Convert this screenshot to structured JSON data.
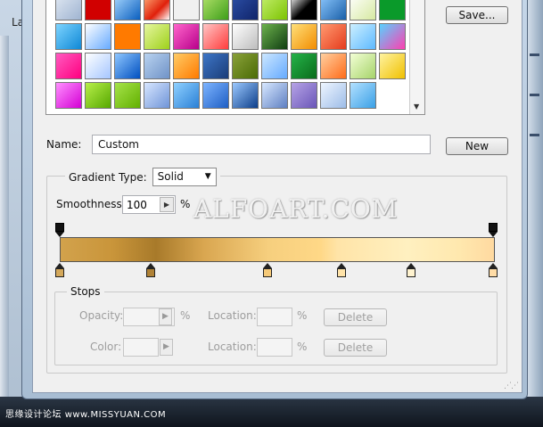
{
  "background": {
    "window_title": "Lay",
    "watermark_bottom_cn": "思缘设计论坛",
    "watermark_bottom_url": "www.MISSYUAN.COM"
  },
  "watermark": "ALFOART.COM",
  "presets": {
    "save_label": "Save...",
    "swatches": [
      "linear-gradient(135deg,#dfe7f2,#9fb4d1)",
      "#d10000",
      "linear-gradient(135deg,#a9d8ff,#0a5fbf)",
      "linear-gradient(135deg,#ffb07a,#e0200a 60%,#fff)",
      "#f0f0f0",
      "linear-gradient(135deg,#b4e36b,#3d9e1a)",
      "linear-gradient(135deg,#2c4fa6,#10246a)",
      "linear-gradient(135deg,#c4ef6f,#7cc300)",
      "linear-gradient(135deg,#ffffff,#000000 55%)",
      "linear-gradient(135deg,#8ec9ff,#1a5fa8)",
      "linear-gradient(135deg,#ffffff,#d6e9a0)",
      "",
      "#0a9a2a",
      "linear-gradient(135deg,#7ed4ff,#0f88d6)",
      "linear-gradient(135deg,#ffffff,#66aaff)",
      "#ff7a00",
      "linear-gradient(135deg,#e6f6a0,#9ed11a)",
      "linear-gradient(135deg,#ff66cc,#b8008a)",
      "linear-gradient(135deg,#ffc6c6,#ff3c3c)",
      "linear-gradient(135deg,#ffffff,#bdbdbd)",
      "linear-gradient(135deg,#6db24c,#0f3d12)",
      "linear-gradient(135deg,#ffe07a,#f28c00)",
      "linear-gradient(135deg,#ff9a70,#e53b1c)",
      "linear-gradient(135deg,#cdefff,#5db9ff)",
      "linear-gradient(135deg,#58d1ff,#ff3fb0)",
      "linear-gradient(135deg,#ff5bc0,#ff007f)",
      "linear-gradient(135deg,#ffffff,#a5c6ff)",
      "linear-gradient(135deg,#8fc7ff,#0050c0)",
      "linear-gradient(135deg,#b9d3f0,#6f92c7)",
      "linear-gradient(135deg,#ffcc66,#ff7a00)",
      "linear-gradient(135deg,#3e76c7,#1a3c78)",
      "linear-gradient(135deg,#8aa13a,#4a6b05)",
      "linear-gradient(135deg,#cce7ff,#66aaff)",
      "linear-gradient(135deg,#25b34a,#0a6b1a)",
      "linear-gradient(135deg,#ffd0a0,#ff6b1a)",
      "linear-gradient(135deg,#f3ffd6,#a6d36a)",
      "linear-gradient(135deg,#fff3a0,#f0c000)",
      "linear-gradient(135deg,#ff90ff,#d400d4)",
      "linear-gradient(135deg,#b8ef4a,#56a800)",
      "linear-gradient(135deg,#a6e34a,#62b000)",
      "linear-gradient(135deg,#d7e6ff,#6f94d8)",
      "linear-gradient(135deg,#8fd0ff,#2a80d6)",
      "linear-gradient(135deg,#7db4ff,#1e5ec4)",
      "linear-gradient(135deg,#9cc9ff,#0c3e8a)",
      "linear-gradient(135deg,#d8e8ff,#5e7fc2)",
      "linear-gradient(135deg,#b6a3e6,#6a56b8)",
      "linear-gradient(135deg,#eef5ff,#9dbde8)",
      "linear-gradient(135deg,#b3e0ff,#3aa0e6)"
    ]
  },
  "name": {
    "label": "Name:",
    "value": "Custom",
    "new_label": "New"
  },
  "gradient_type": {
    "label": "Gradient Type:",
    "value": "Solid"
  },
  "smoothness": {
    "label": "Smoothness:",
    "value": "100",
    "unit": "%"
  },
  "gradient": {
    "css": "linear-gradient(90deg,#d2a24c 0%,#c9953a 12%,#a87a2a 22%,#d9a650 33%,#f6cf7e 48%,#ffd887 60%,#ffe4a8 64%,#fff0c0 80%,#ffe8ae 92%,#ffd9a0 100%)",
    "color_stops": [
      {
        "pos": 0.0,
        "color": "#d4a85a"
      },
      {
        "pos": 0.21,
        "color": "#b08236"
      },
      {
        "pos": 0.48,
        "color": "#f5c978"
      },
      {
        "pos": 0.65,
        "color": "#ffe3a8"
      },
      {
        "pos": 0.81,
        "color": "#fff3cf"
      },
      {
        "pos": 1.0,
        "color": "#ffdca6"
      }
    ],
    "opacity_stops": [
      0.0,
      1.0
    ]
  },
  "stops": {
    "legend": "Stops",
    "opacity_label": "Opacity:",
    "opacity_unit": "%",
    "location_label": "Location:",
    "location_unit": "%",
    "color_label": "Color:",
    "delete_label": "Delete"
  }
}
